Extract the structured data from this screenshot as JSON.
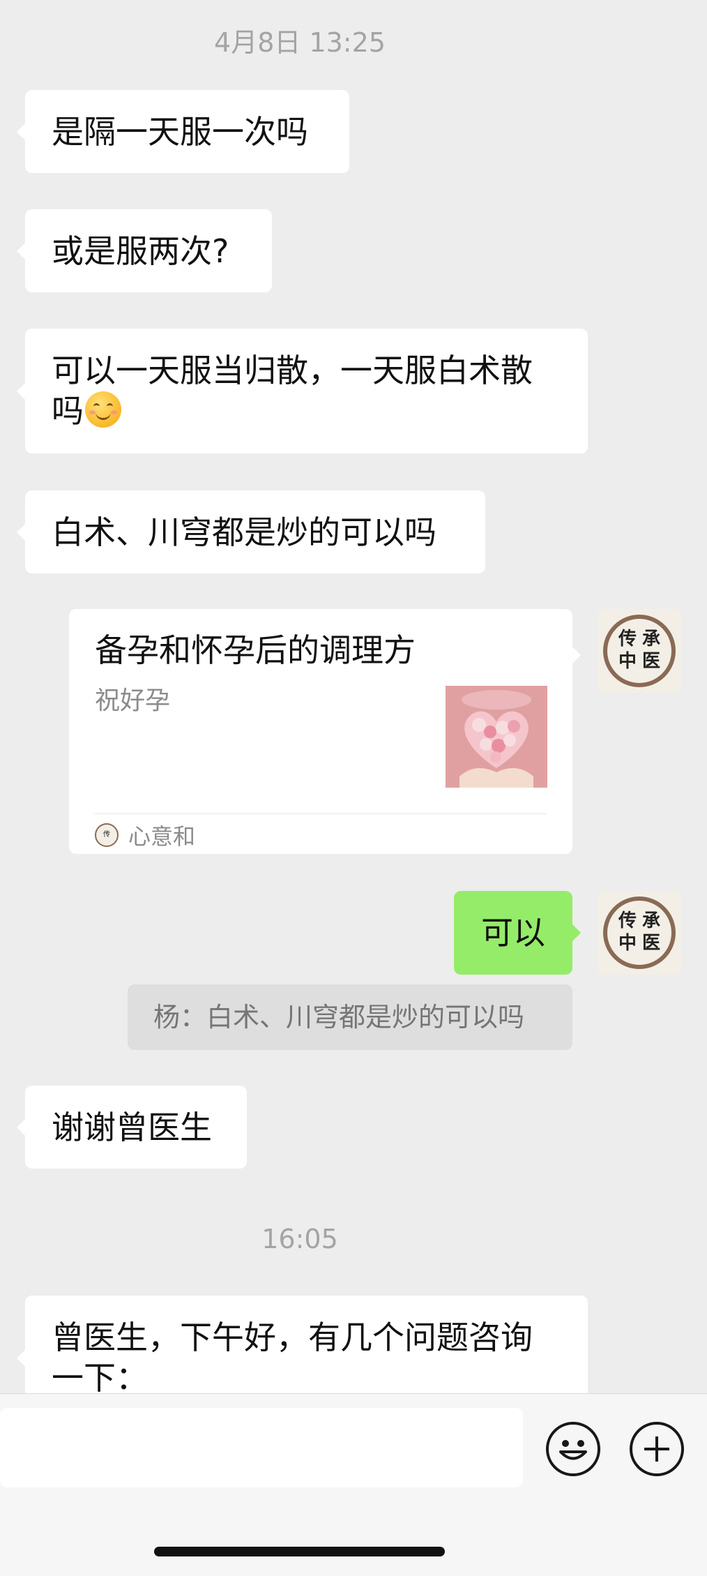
{
  "timestamps": {
    "first": "4月8日 13:25",
    "second": "16:05"
  },
  "messages": {
    "m1": "是隔一天服一次吗",
    "m2": "或是服两次?",
    "m3_line1": "可以一天服当归散，一天服白术散",
    "m3_line2": "吗",
    "m4": "白术、川穹都是炒的可以吗",
    "reply": "可以",
    "m5": "谢谢曾医生",
    "m6_line1": "曾医生，下午好，有几个问题咨询",
    "m6_line2": "一下："
  },
  "link_card": {
    "title": "备孕和怀孕后的调理方",
    "description": "祝好孕",
    "source": "心意和"
  },
  "quote": "杨：白术、川穹都是炒的可以吗",
  "avatar": {
    "chars": [
      "传",
      "承",
      "中",
      "医"
    ]
  },
  "icons": {
    "emoji": "emoji-icon",
    "plus": "plus-icon"
  },
  "colors": {
    "background": "#ededed",
    "sent_bubble": "#95ec69",
    "received_bubble": "#ffffff"
  }
}
